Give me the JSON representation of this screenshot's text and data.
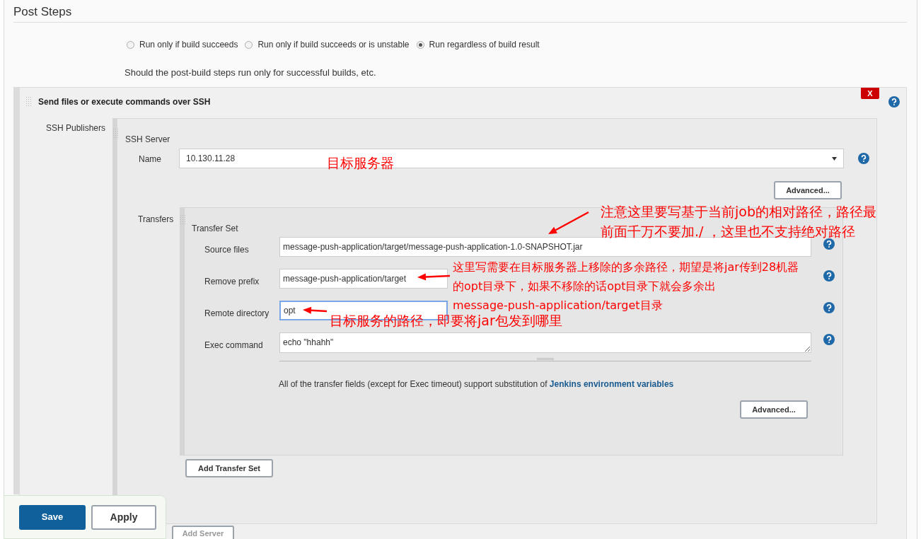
{
  "section_title": "Post Steps",
  "run_conditions": [
    {
      "label": "Run only if build succeeds",
      "selected": false
    },
    {
      "label": "Run only if build succeeds or is unstable",
      "selected": false
    },
    {
      "label": "Run regardless of build result",
      "selected": true
    }
  ],
  "run_conditions_hint": "Should the post-build steps run only for successful builds, etc.",
  "builder": {
    "title": "Send files or execute commands over SSH",
    "delete_label": "X",
    "publishers_label": "SSH Publishers",
    "server": {
      "title": "SSH Server",
      "name_label": "Name",
      "name_value": "10.130.11.28",
      "advanced_button": "Advanced...",
      "transfers_label": "Transfers",
      "transfer_set": {
        "title": "Transfer Set",
        "fields": [
          {
            "label": "Source files",
            "value": "message-push-application/target/message-push-application-1.0-SNAPSHOT.jar",
            "kind": "input",
            "focused": false
          },
          {
            "label": "Remove prefix",
            "value": "message-push-application/target",
            "kind": "input",
            "focused": false
          },
          {
            "label": "Remote directory",
            "value": "opt",
            "kind": "input",
            "focused": true
          },
          {
            "label": "Exec command",
            "value": "echo \"hhahh\"",
            "kind": "textarea",
            "focused": false
          }
        ],
        "note": "All of the transfer fields (except for Exec timeout) support substitution of",
        "note_link": "Jenkins environment variables",
        "advanced_button": "Advanced..."
      },
      "add_transfer_set_button": "Add Transfer Set"
    },
    "add_server_button": "Add Server"
  },
  "annotations": [
    {
      "lines": [
        "目标服务器"
      ]
    },
    {
      "lines": [
        "注意这里要写基于当前job的相对路径，路径最",
        "前面千万不要加./ ，这里也不支持绝对路径"
      ]
    },
    {
      "lines": [
        "这里写需要在目标服务器上移除的多余路径，期望是将jar传到28机器",
        "的opt目录下，如果不移除的话opt目录下就会多余出",
        "message-push-application/target目录"
      ]
    },
    {
      "lines": [
        "目标服务的路径，即要将jar包发到哪里"
      ]
    }
  ],
  "buttons": [
    {
      "label": "Save",
      "kind": "primary"
    },
    {
      "label": "Apply",
      "kind": "secondary"
    }
  ]
}
